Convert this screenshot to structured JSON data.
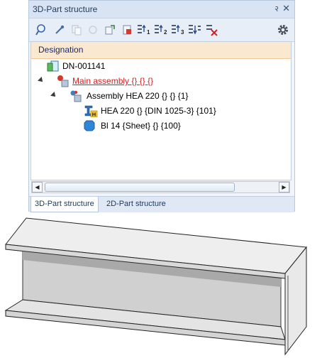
{
  "panel": {
    "title": "3D-Part structure",
    "pin_glyph": "२",
    "close_glyph": "✕"
  },
  "toolbar": {
    "icons": [
      "search-icon",
      "eyedropper-icon",
      "copy-icon",
      "refresh-icon",
      "export-icon",
      "paste-icon",
      "sort-1-icon",
      "sort-2-icon",
      "sort-3-icon",
      "sort-down-icon",
      "clear-icon",
      "settings-icon"
    ],
    "labels": {
      "sort1": "1",
      "sort2": "2",
      "sort3": "3"
    }
  },
  "tree": {
    "header": "Designation",
    "rows": [
      {
        "label": "DN-001141",
        "icon": "document-icon"
      },
      {
        "label": "Main assembly {} {} {}",
        "icon": "assembly-icon",
        "highlight": true
      },
      {
        "label": "Assembly HEA 220 {} {} {1}",
        "icon": "assembly-icon"
      },
      {
        "label": "HEA 220 {} {DIN 1025-3} {101}",
        "icon": "beam-icon",
        "badge": "H"
      },
      {
        "label": "Bl 14 {Sheet} {} {100}",
        "icon": "sheet-icon"
      }
    ]
  },
  "tabs": [
    {
      "label": "3D-Part structure",
      "active": true
    },
    {
      "label": "2D-Part structure",
      "active": false
    }
  ],
  "colors": {
    "highlight_text": "#d42020",
    "header_bg": "#fbe8d1",
    "panel_bg": "#f1f5fb"
  }
}
